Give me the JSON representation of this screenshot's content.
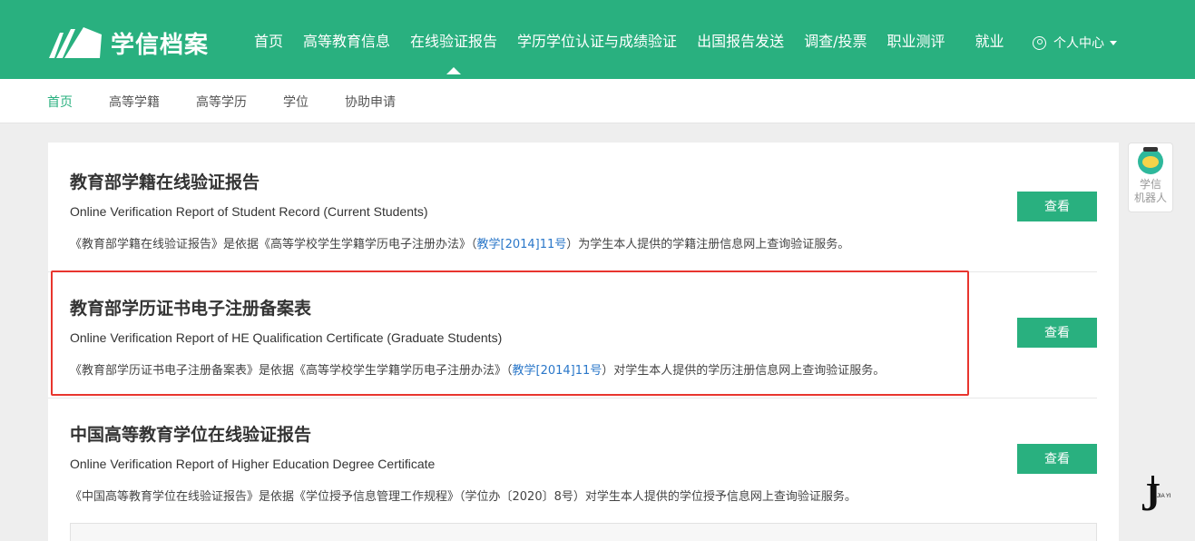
{
  "header": {
    "logo_text": "学信档案",
    "nav": [
      {
        "label": "首页",
        "name": "nav-home"
      },
      {
        "label": "高等教育信息",
        "name": "nav-higher-edu-info"
      },
      {
        "label": "在线验证报告",
        "name": "nav-online-verification",
        "active": true
      },
      {
        "label": "学历学位认证与成绩验证",
        "name": "nav-certification"
      },
      {
        "label": "出国报告发送",
        "name": "nav-overseas-report"
      },
      {
        "label": "调查/投票",
        "name": "nav-survey"
      },
      {
        "label": "职业测评",
        "name": "nav-career-assessment"
      },
      {
        "label": "就业",
        "name": "nav-employment"
      }
    ],
    "user_center": "个人中心"
  },
  "subnav": {
    "items": [
      "首页",
      "高等学籍",
      "高等学历",
      "学位",
      "协助申请"
    ],
    "active_index": 0
  },
  "reports": [
    {
      "title": "教育部学籍在线验证报告",
      "subtitle": "Online Verification Report of Student Record (Current Students)",
      "desc_before": "《教育部学籍在线验证报告》是依据《高等学校学生学籍学历电子注册办法》（",
      "desc_link": "教学[2014]11号",
      "desc_after": "）为学生本人提供的学籍注册信息网上查询验证服务。",
      "button": "查看"
    },
    {
      "title": "教育部学历证书电子注册备案表",
      "subtitle": "Online Verification Report of HE Qualification Certificate (Graduate Students)",
      "desc_before": "《教育部学历证书电子注册备案表》是依据《高等学校学生学籍学历电子注册办法》（",
      "desc_link": "教学[2014]11号",
      "desc_after": "）对学生本人提供的学历注册信息网上查询验证服务。",
      "button": "查看",
      "highlighted": true
    },
    {
      "title": "中国高等教育学位在线验证报告",
      "subtitle": "Online Verification Report of Higher Education Degree Certificate",
      "desc_before": "《中国高等教育学位在线验证报告》是依据《学位授予信息管理工作规程》（学位办〔2020〕8号）对学生本人提供的学位授予信息网上查询验证服务。",
      "desc_link": "",
      "desc_after": "",
      "button": "查看"
    }
  ],
  "robot": {
    "label_line1": "学信",
    "label_line2": "机器人"
  },
  "watermark": {
    "mark": "J",
    "text": "JIA YI"
  },
  "colors": {
    "brand_green": "#29b07f",
    "link_blue": "#2a77c9",
    "highlight_red": "#e8352e"
  }
}
